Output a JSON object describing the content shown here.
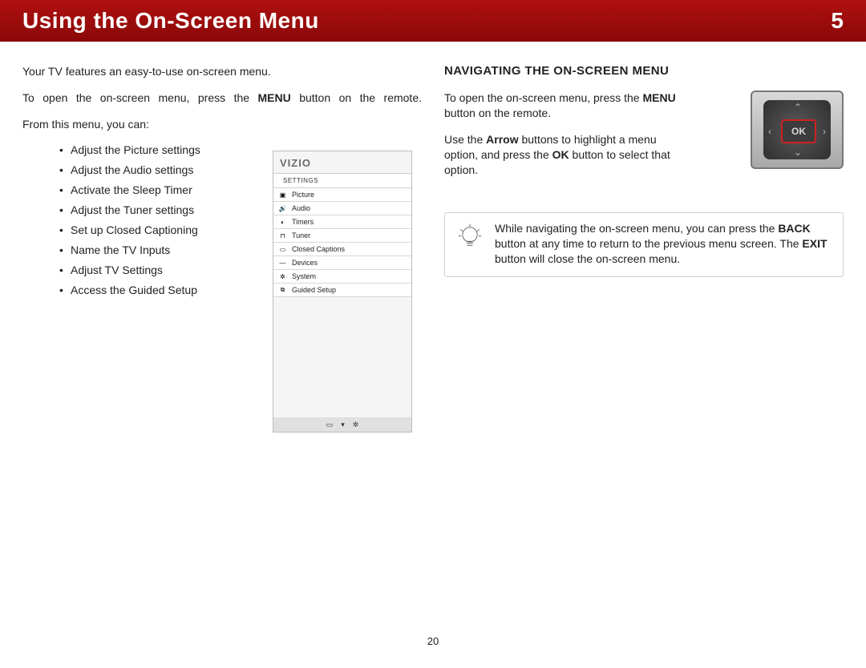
{
  "banner": {
    "title": "Using the On-Screen Menu",
    "chapter": "5"
  },
  "left": {
    "p1": "Your TV features an easy-to-use on-screen menu.",
    "p2a": "To open the on-screen menu, press the ",
    "p2b": "MENU",
    "p2c": " button on the remote.",
    "p3": "From this menu, you can:",
    "bullets": [
      "Adjust the Picture settings",
      "Adjust the Audio settings",
      "Activate the Sleep Timer",
      "Adjust the Tuner settings",
      "Set up Closed Captioning",
      "Name the TV Inputs",
      "Adjust TV Settings",
      "Access the Guided Setup"
    ]
  },
  "menu": {
    "brand": "VIZIO",
    "header": "SETTINGS",
    "rows": [
      "Picture",
      "Audio",
      "Timers",
      "Tuner",
      "Closed Captions",
      "Devices",
      "System",
      "Guided Setup"
    ],
    "icons": [
      "▣",
      "🔊",
      "◐",
      "⊓",
      "▭",
      "—",
      "✲",
      "⧉"
    ]
  },
  "right": {
    "heading": "NAVIGATING THE ON-SCREEN MENU",
    "p1a": "To open the on-screen menu, press the ",
    "p1b": "MENU",
    "p1c": " button on the remote.",
    "p2a": "Use the ",
    "p2b": "Arrow",
    "p2c": " buttons to highlight a menu option, and press the ",
    "p2d": "OK",
    "p2e": " button to select that option.",
    "remote_ok": "OK"
  },
  "tip": {
    "t1": "While navigating the on-screen menu, you can press the ",
    "t2": "BACK",
    "t3": " button at any time to return to the previous menu screen. The ",
    "t4": "EXIT",
    "t5": " button will close the on-screen menu."
  },
  "page": "20"
}
